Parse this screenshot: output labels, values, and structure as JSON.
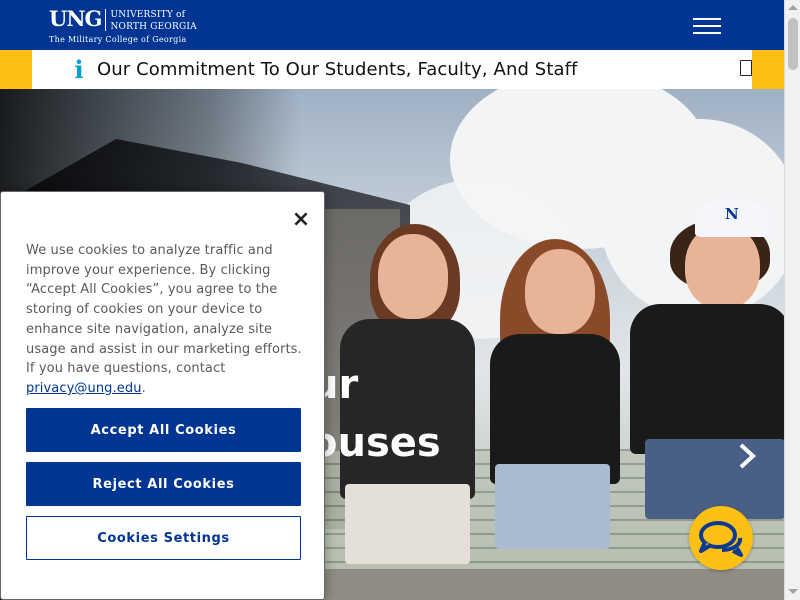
{
  "header": {
    "logo_mark": "UNG",
    "logo_line1": "UNIVERSITY of",
    "logo_line2": "NORTH GEORGIA",
    "logo_tagline": "The Military College of Georgia",
    "menu_icon": "hamburger-menu-icon"
  },
  "alert": {
    "icon": "info-icon",
    "text": "Our Commitment To Our Students, Faculty, And Staff",
    "close_icon": "close-box-icon"
  },
  "hero": {
    "title_line1": "ur",
    "title_line2": "ouses",
    "next_icon": "chevron-right-icon",
    "cap_text": "N"
  },
  "cookie": {
    "close_label": "×",
    "text_main": "We use cookies to analyze traffic and improve your experience. By clicking “Accept All Cookies”, you agree to the storing of cookies on your device to enhance site navigation, analyze site usage and assist in our marketing efforts. If you have questions, contact ",
    "link": "privacy@ung.edu",
    "text_end": ".",
    "accept_label": "Accept All Cookies",
    "reject_label": "Reject All Cookies",
    "settings_label": "Cookies Settings"
  },
  "chat": {
    "icon": "chat-bubbles-icon"
  },
  "colors": {
    "brand_blue": "#003594",
    "brand_gold": "#fcc015",
    "info_blue": "#00a0d2"
  }
}
